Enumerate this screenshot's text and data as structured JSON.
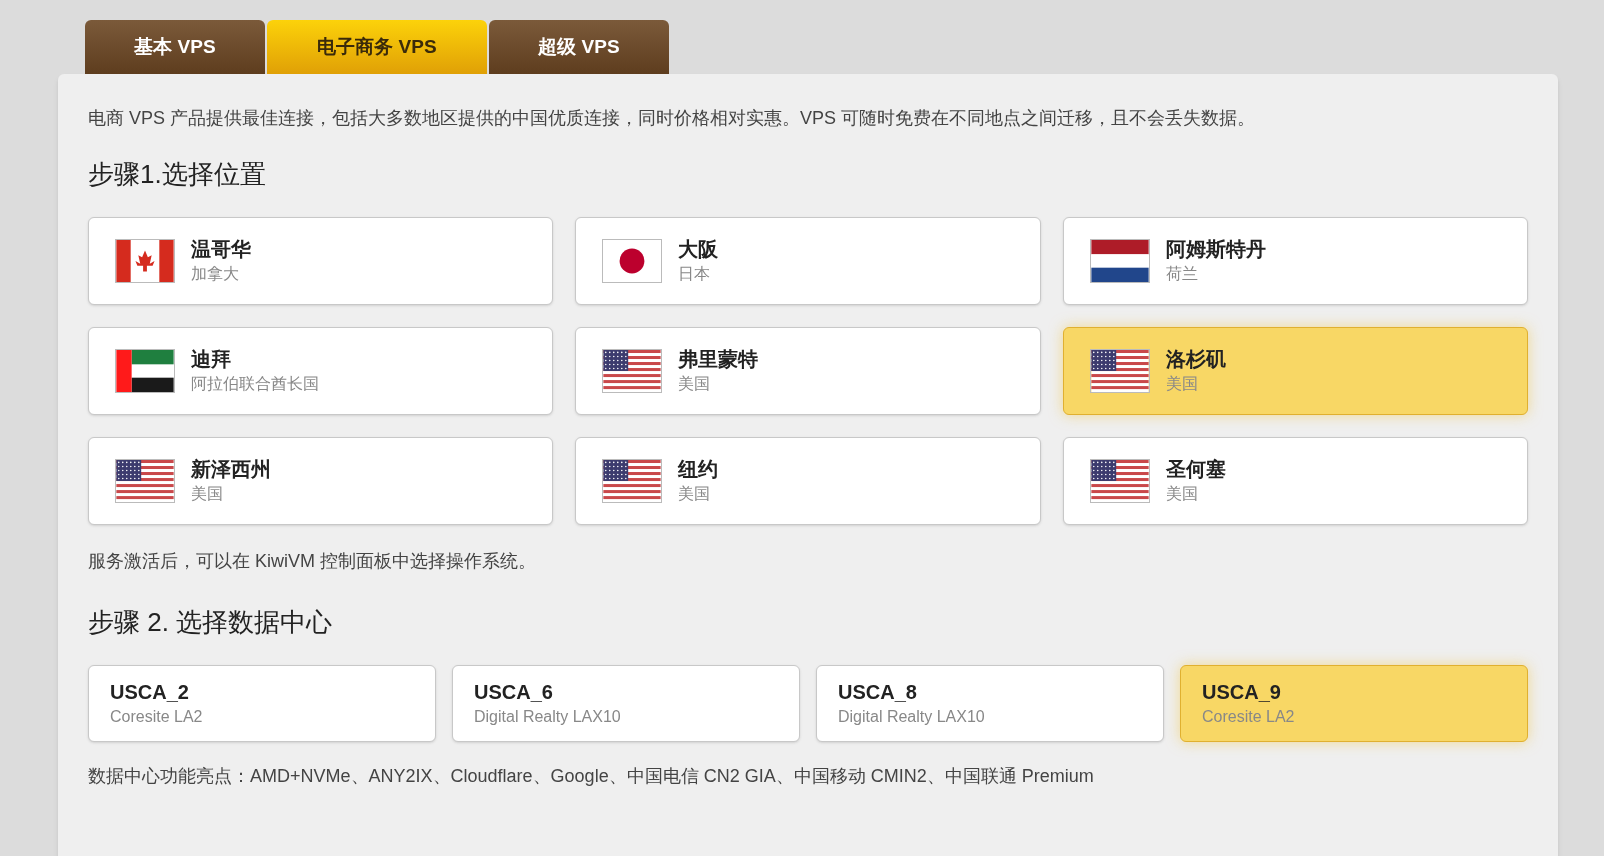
{
  "tabs": [
    {
      "label": "基本 VPS",
      "selected": false
    },
    {
      "label": "电子商务 VPS",
      "selected": true
    },
    {
      "label": "超级 VPS",
      "selected": false
    }
  ],
  "description": "电商 VPS 产品提供最佳连接，包括大多数地区提供的中国优质连接，同时价格相对实惠。VPS 可随时免费在不同地点之间迁移，且不会丢失数据。",
  "step1": {
    "heading": "步骤1.选择位置",
    "locations": [
      {
        "kind": "canada",
        "city": "温哥华",
        "country": "加拿大",
        "selected": false
      },
      {
        "kind": "japan",
        "city": "大阪",
        "country": "日本",
        "selected": false
      },
      {
        "kind": "netherlands",
        "city": "阿姆斯特丹",
        "country": "荷兰",
        "selected": false
      },
      {
        "kind": "uae",
        "city": "迪拜",
        "country": "阿拉伯联合酋长国",
        "selected": false
      },
      {
        "kind": "usa",
        "city": "弗里蒙特",
        "country": "美国",
        "selected": false
      },
      {
        "kind": "usa",
        "city": "洛杉矶",
        "country": "美国",
        "selected": true
      },
      {
        "kind": "usa",
        "city": "新泽西州",
        "country": "美国",
        "selected": false
      },
      {
        "kind": "usa",
        "city": "纽约",
        "country": "美国",
        "selected": false
      },
      {
        "kind": "usa",
        "city": "圣何塞",
        "country": "美国",
        "selected": false
      }
    ],
    "note": "服务激活后，可以在 KiwiVM 控制面板中选择操作系统。"
  },
  "step2": {
    "heading": "步骤 2. 选择数据中心",
    "datacenters": [
      {
        "code": "USCA_2",
        "facility": "Coresite LA2",
        "selected": false
      },
      {
        "code": "USCA_6",
        "facility": "Digital Realty LAX10",
        "selected": false
      },
      {
        "code": "USCA_8",
        "facility": "Digital Realty LAX10",
        "selected": false
      },
      {
        "code": "USCA_9",
        "facility": "Coresite LA2",
        "selected": true
      }
    ],
    "note": "数据中心功能亮点：AMD+NVMe、ANY2IX、Cloudflare、Google、中国电信 CN2 GIA、中国移动 CMIN2、中国联通 Premium"
  }
}
